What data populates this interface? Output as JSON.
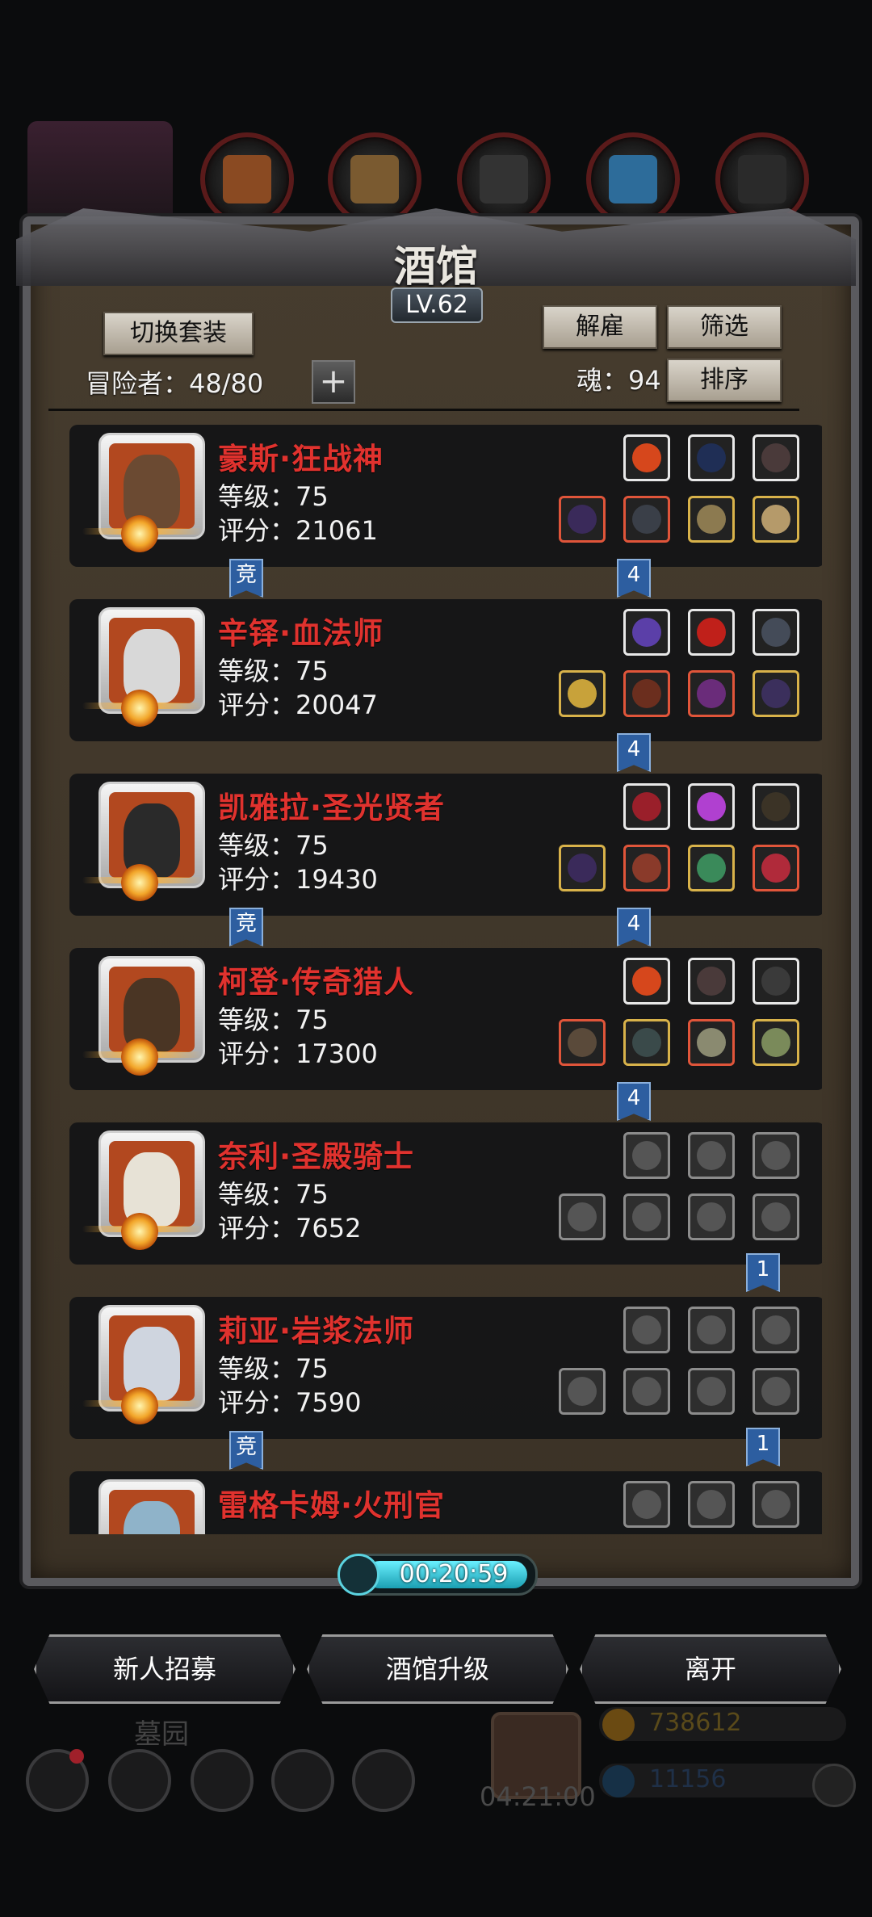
{
  "title": "酒馆",
  "level": "LV.62",
  "buttons": {
    "switch_outfit": "切换套装",
    "dismiss": "解雇",
    "filter": "筛选",
    "sort": "排序"
  },
  "adventurers": {
    "label": "冒险者：48/80"
  },
  "soul": {
    "label": "魂：94"
  },
  "plus_symbol": "+",
  "heroes": [
    {
      "name": "豪斯·狂战神",
      "level": "等级：75",
      "score": "评分：21061",
      "tag_left": "竞",
      "tag_right": "4",
      "face": "#6b4a32",
      "equip_empty": false
    },
    {
      "name": "辛铎·血法师",
      "level": "等级：75",
      "score": "评分：20047",
      "tag_left": "",
      "tag_right": "4",
      "face": "#d8d8d8",
      "equip_empty": false
    },
    {
      "name": "凯雅拉·圣光贤者",
      "level": "等级：75",
      "score": "评分：19430",
      "tag_left": "竞",
      "tag_right": "4",
      "face": "#2a2a2a",
      "equip_empty": false
    },
    {
      "name": "柯登·传奇猎人",
      "level": "等级：75",
      "score": "评分：17300",
      "tag_left": "",
      "tag_right": "4",
      "face": "#4a3524",
      "equip_empty": false
    },
    {
      "name": "奈利·圣殿骑士",
      "level": "等级：75",
      "score": "评分：7652",
      "tag_left": "",
      "tag_right": "1",
      "face": "#e7e2d6",
      "equip_empty": true
    },
    {
      "name": "莉亚·岩浆法师",
      "level": "等级：75",
      "score": "评分：7590",
      "tag_left": "竞",
      "tag_right": "1",
      "face": "#cfd5df",
      "equip_empty": true
    },
    {
      "name": "雷格卡姆·火刑官",
      "level": "",
      "score": "",
      "tag_left": "",
      "tag_right": "",
      "face": "#8fb3c9",
      "equip_empty": true
    }
  ],
  "timer": "00:20:59",
  "bottom_buttons": {
    "recruit": "新人招募",
    "upgrade": "酒馆升级",
    "leave": "离开"
  },
  "background": {
    "graveyard": "墓园",
    "gift_timer": "04:21:00",
    "gold": "738612",
    "gems": "11156"
  },
  "colors": {
    "hero_name": "#e0322e",
    "panel": "#463c2e",
    "timer_fill": "#3fd4e6"
  },
  "icons": [
    "chest-icon",
    "wood-icon",
    "anvil-icon",
    "crystal-icon",
    "iron-icon",
    "clock-icon",
    "gift-icon",
    "gold-icon",
    "gem-icon",
    "settings-icon"
  ]
}
